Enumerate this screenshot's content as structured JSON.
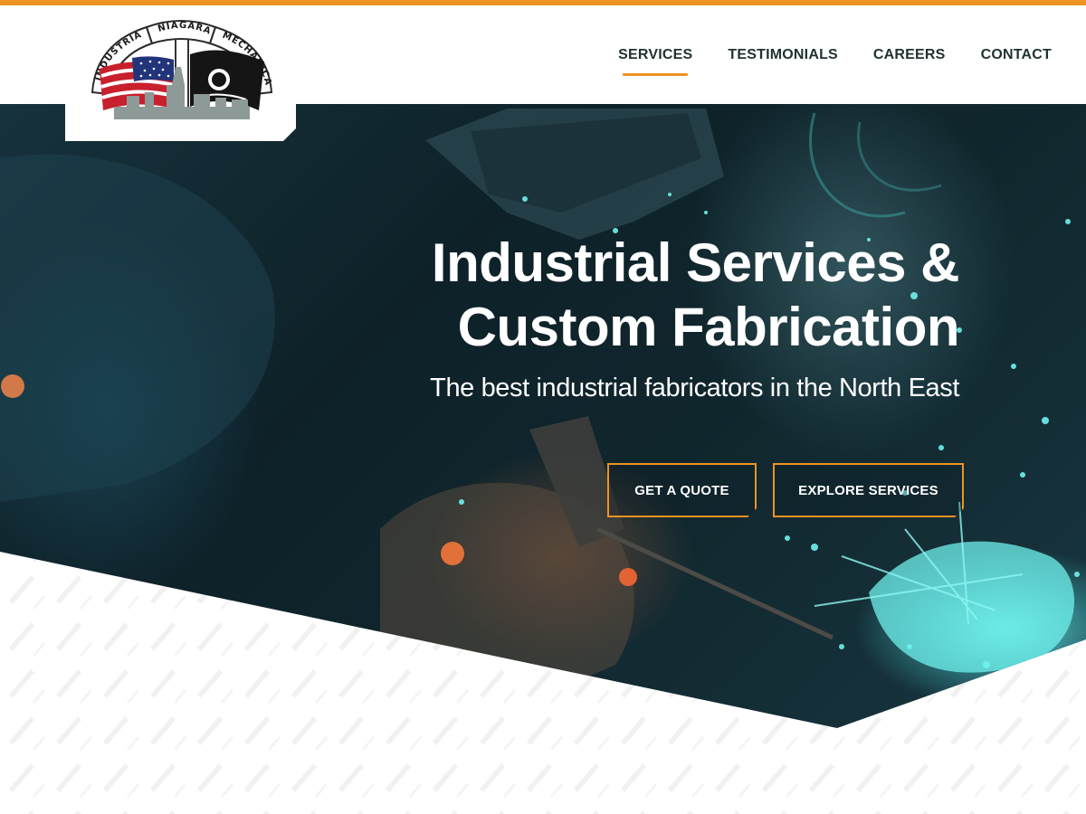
{
  "logo": {
    "arc_words": [
      "INDUSTRIAL",
      "NIAGARA",
      "MECHANICAL"
    ]
  },
  "nav": {
    "items": [
      {
        "label": "SERVICES",
        "active": true
      },
      {
        "label": "TESTIMONIALS",
        "active": false
      },
      {
        "label": "CAREERS",
        "active": false
      },
      {
        "label": "CONTACT",
        "active": false
      }
    ]
  },
  "hero": {
    "title_line1": "Industrial Services &",
    "title_line2": "Custom Fabrication",
    "subtitle": "The best industrial fabricators in the North East",
    "cta_quote_label": "GET A QUOTE",
    "cta_explore_label": "EXPLORE SERVICES"
  },
  "colors": {
    "accent": "#ee9222",
    "nav_text": "#1f3232",
    "hero_text": "#ffffff",
    "spark": "#6ff2ee"
  },
  "icons": [
    "american-flag-icon",
    "pow-mia-flag-icon",
    "factory-skyline-icon"
  ]
}
